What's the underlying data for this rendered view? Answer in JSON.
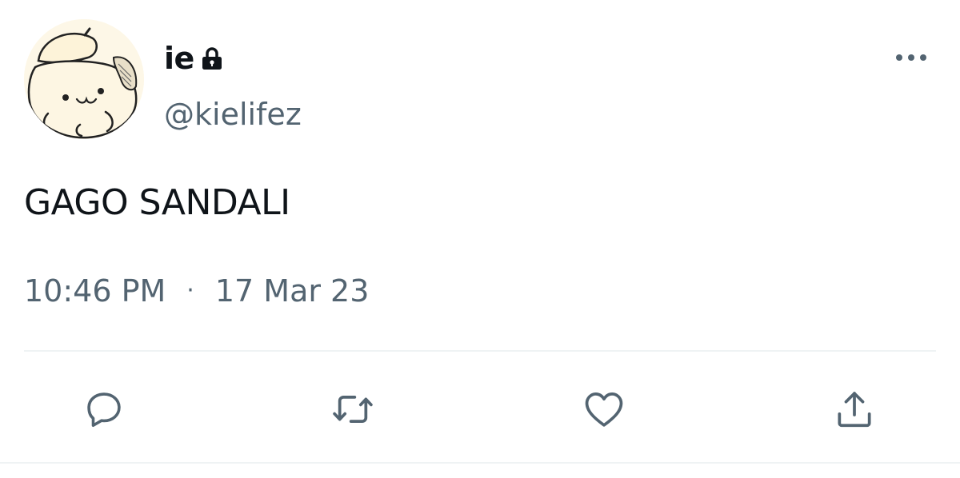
{
  "tweet": {
    "author": {
      "display_name": "ie",
      "handle": "@kielifez",
      "protected_icon": "lock-icon",
      "avatar_icon": "cartoon-dog-avatar"
    },
    "text": "GAGO SANDALI",
    "time": "10:46 PM",
    "separator": "·",
    "date": "17 Mar 23",
    "more_icon": "more-horizontal-icon",
    "actions": [
      {
        "name": "reply",
        "icon": "comment-icon"
      },
      {
        "name": "retweet",
        "icon": "retweet-icon"
      },
      {
        "name": "like",
        "icon": "heart-icon"
      },
      {
        "name": "share",
        "icon": "share-icon"
      }
    ],
    "colors": {
      "text_primary": "#0f1419",
      "text_secondary": "#536471",
      "divider": "#eff3f4"
    }
  }
}
